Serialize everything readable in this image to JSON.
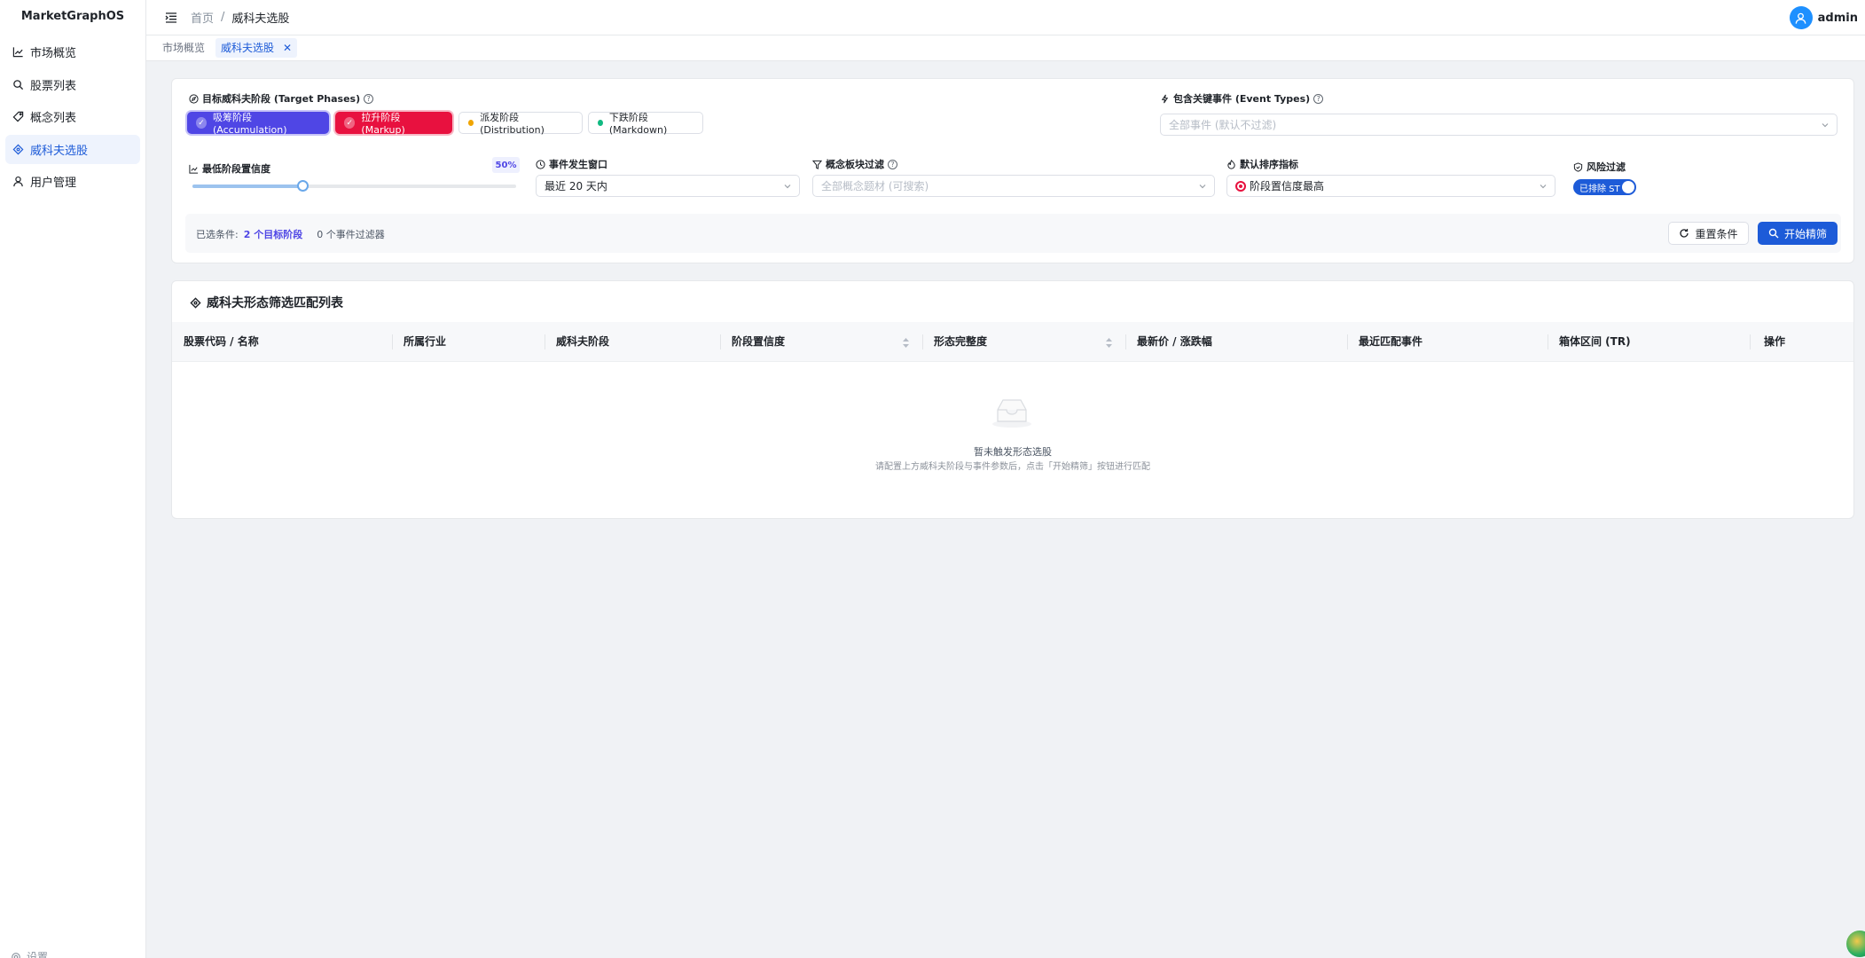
{
  "app": {
    "brand": "MarketGraphOS"
  },
  "sidebar": {
    "items": [
      {
        "label": "市场概览",
        "icon": "line-chart-icon",
        "active": false
      },
      {
        "label": "股票列表",
        "icon": "search-icon",
        "active": false
      },
      {
        "label": "概念列表",
        "icon": "tag-icon",
        "active": false
      },
      {
        "label": "威科夫选股",
        "icon": "target-icon",
        "active": true
      },
      {
        "label": "用户管理",
        "icon": "user-icon",
        "active": false
      }
    ],
    "bottom_label": "设置"
  },
  "header": {
    "breadcrumb_home": "首页",
    "breadcrumb_sep": "/",
    "breadcrumb_current": "威科夫选股",
    "user_name": "admin"
  },
  "tabs": [
    {
      "label": "市场概览",
      "active": false
    },
    {
      "label": "威科夫选股",
      "active": true
    }
  ],
  "filters": {
    "target_phases_label": "目标威科夫阶段 (Target Phases)",
    "phases": [
      {
        "label": "吸筹阶段 (Accumulation)",
        "selected": true,
        "color": "#4f46e5"
      },
      {
        "label": "拉升阶段 (Markup)",
        "selected": true,
        "color": "#e8113f"
      },
      {
        "label": "派发阶段 (Distribution)",
        "selected": false,
        "color": "#f0a500"
      },
      {
        "label": "下跌阶段 (Markdown)",
        "selected": false,
        "color": "#10b981"
      }
    ],
    "event_types_label": "包含关键事件 (Event Types)",
    "event_types_placeholder": "全部事件 (默认不过滤)",
    "min_confidence_label": "最低阶段置信度",
    "min_confidence_value": "50%",
    "min_confidence_fraction": 0.34,
    "window_label": "事件发生窗口",
    "window_value": "最近 20 天内",
    "concept_label": "概念板块过滤",
    "concept_placeholder": "全部概念题材 (可搜索)",
    "sort_label": "默认排序指标",
    "sort_value": "阶段置信度最高",
    "risk_label": "风险过滤",
    "risk_toggle_label": "已排除 ST",
    "risk_toggle_on": true
  },
  "summary": {
    "prefix": "已选条件:",
    "phases_count": "2 个目标阶段",
    "events_count": "0 个事件过滤器",
    "reset_label": "重置条件",
    "start_label": "开始精筛"
  },
  "results": {
    "title": "威科夫形态筛选匹配列表",
    "columns": [
      "股票代码 / 名称",
      "所属行业",
      "威科夫阶段",
      "阶段置信度",
      "形态完整度",
      "最新价 / 涨跌幅",
      "最近匹配事件",
      "箱体区间 (TR)",
      "操作"
    ],
    "empty_title": "暂未触发形态选股",
    "empty_subtitle": "请配置上方威科夫阶段与事件参数后，点击「开始精筛」按钮进行匹配"
  }
}
